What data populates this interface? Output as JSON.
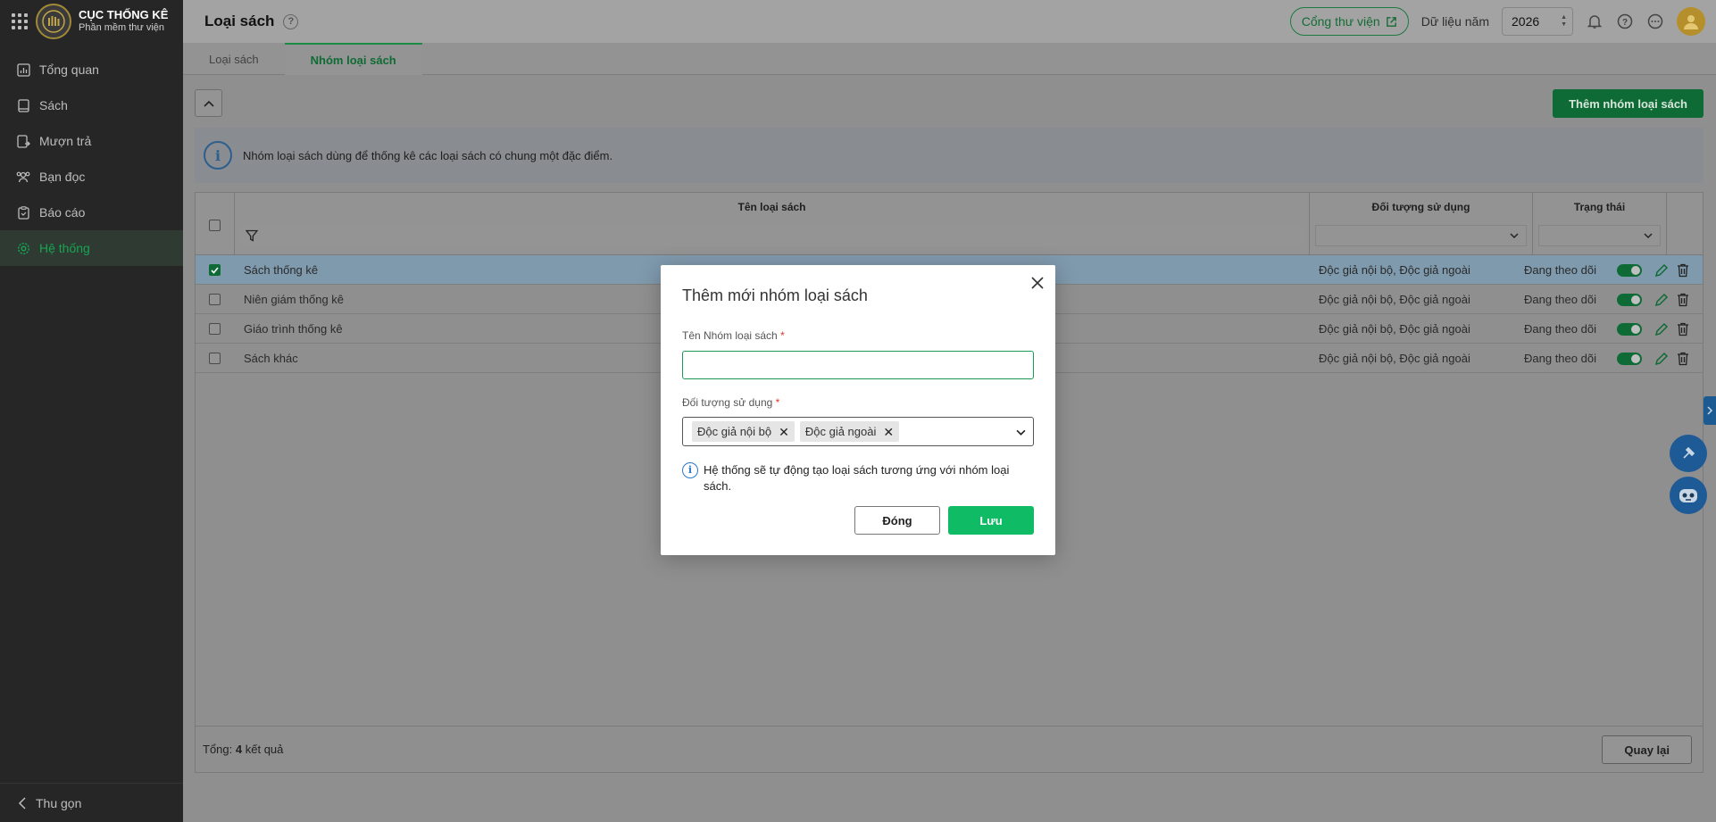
{
  "brand": {
    "title": "CỤC THỐNG KÊ",
    "subtitle": "Phần mềm thư viện"
  },
  "header": {
    "page_title": "Loại sách",
    "portal_label": "Cổng thư viện",
    "year_label": "Dữ liệu năm",
    "year_value": "2026"
  },
  "sidebar": {
    "items": [
      {
        "label": "Tổng quan",
        "icon": "chart-icon"
      },
      {
        "label": "Sách",
        "icon": "book-icon"
      },
      {
        "label": "Mượn trả",
        "icon": "borrow-icon"
      },
      {
        "label": "Bạn đọc",
        "icon": "readers-icon"
      },
      {
        "label": "Báo cáo",
        "icon": "report-icon"
      },
      {
        "label": "Hệ thống",
        "icon": "gear-icon",
        "active": true
      }
    ],
    "collapse_label": "Thu gọn"
  },
  "tabs": [
    {
      "label": "Loại sách"
    },
    {
      "label": "Nhóm loại sách",
      "active": true
    }
  ],
  "toolbar": {
    "add_label": "Thêm nhóm loại sách"
  },
  "info_text": "Nhóm loại sách dùng để thống kê các loại sách có chung một đặc điểm.",
  "table": {
    "columns": [
      "Tên loại sách",
      "Đối tượng sử dụng",
      "Trạng thái"
    ],
    "rows": [
      {
        "name": "Sách thống kê",
        "audience": "Độc giả nội bộ, Độc giả ngoài",
        "status": "Đang theo dõi",
        "checked": true
      },
      {
        "name": "Niên giám thống kê",
        "audience": "Độc giả nội bộ, Độc giả ngoài",
        "status": "Đang theo dõi",
        "checked": false
      },
      {
        "name": "Giáo trình thống kê",
        "audience": "Độc giả nội bộ, Độc giả ngoài",
        "status": "Đang theo dõi",
        "checked": false
      },
      {
        "name": "Sách khác",
        "audience": "Độc giả nội bộ, Độc giả ngoài",
        "status": "Đang theo dõi",
        "checked": false
      }
    ],
    "footer_prefix": "Tổng:",
    "footer_count": "4",
    "footer_suffix": "kết quả",
    "back_label": "Quay lại"
  },
  "modal": {
    "title": "Thêm mới nhóm loại sách",
    "name_label": "Tên Nhóm loại sách",
    "name_value": "",
    "audience_label": "Đối tượng sử dụng",
    "audience_chips": [
      "Độc giả nội bộ",
      "Độc giả ngoài"
    ],
    "hint": "Hệ thống sẽ tự động tạo loại sách tương ứng với nhóm loại sách.",
    "close_label": "Đóng",
    "save_label": "Lưu"
  },
  "colors": {
    "accent": "#10bb66",
    "dark_green": "#0f6b36",
    "sidebar_bg": "#262626",
    "info_blue": "#2a78c7"
  }
}
